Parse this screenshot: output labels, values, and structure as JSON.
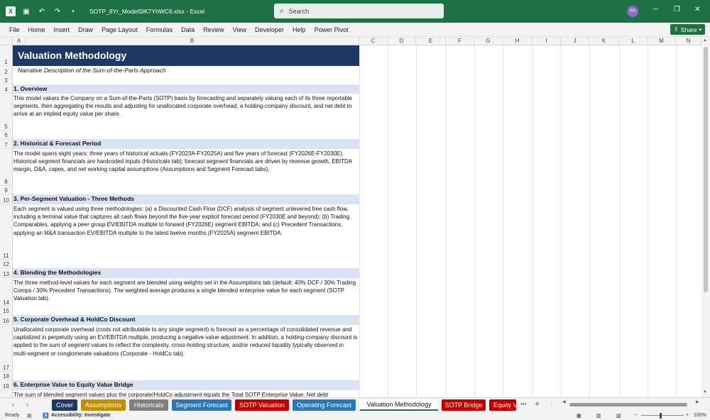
{
  "titlebar": {
    "filename": "SOTP_8Yr_ModelSIK7YhWC6.xlsx",
    "app": "Excel",
    "search_placeholder": "Search",
    "user_initials": "RS",
    "save_icon": "save-icon",
    "undo_icon": "undo-icon",
    "redo_icon": "redo-icon",
    "minimize": "─",
    "restore": "❐",
    "close": "✕"
  },
  "menu": {
    "items": [
      "File",
      "Home",
      "Insert",
      "Draw",
      "Page Layout",
      "Formulas",
      "Data",
      "Review",
      "View",
      "Developer",
      "Help",
      "Power Pivot"
    ],
    "share_label": "Share"
  },
  "columns": [
    "A",
    "B",
    "C",
    "D",
    "E",
    "F",
    "G",
    "H",
    "I",
    "J",
    "K",
    "L",
    "M",
    "N"
  ],
  "rows": [
    "1",
    "2",
    "3",
    "4",
    "5",
    "6",
    "7",
    "8",
    "9",
    "10",
    "11",
    "12",
    "13",
    "14",
    "15",
    "16",
    "17",
    "18",
    "19"
  ],
  "sheet": {
    "title": "Valuation Methodology",
    "subtitle": "Narrative Description of the Sum-of-the-Parts Approach",
    "sections": [
      {
        "heading": "1. Overview",
        "body": "This model values the Company on a Sum-of-the-Parts (SOTP) basis by forecasting and separately valuing each of its three reportable segments, then aggregating the results and adjusting for unallocated corporate overhead, a holding-company discount, and net debt to arrive at an implied equity value per share."
      },
      {
        "heading": "2. Historical & Forecast Period",
        "body": "The model spans eight years: three years of historical actuals (FY2023A-FY2025A) and five years of forecast (FY2026E-FY2030E). Historical segment financials are hardcoded inputs (Historicals tab); forecast segment financials are driven by revenue growth, EBITDA margin, D&A, capex, and net working capital assumptions (Assumptions and Segment Forecast tabs)."
      },
      {
        "heading": "3. Per-Segment Valuation - Three Methods",
        "body": "Each segment is valued using three methodologies: (a) a Discounted Cash Flow (DCF) analysis of segment unlevered free cash flow, including a terminal value that captures all cash flows beyond the five-year explicit forecast period (FY2030E and beyond); (b) Trading Comparables, applying a peer group EV/EBITDA multiple to forward (FY2026E) segment EBITDA; and (c) Precedent Transactions, applying an M&A transaction EV/EBITDA multiple to the latest twelve months (FY2025A) segment EBITDA."
      },
      {
        "heading": "4. Blending the Methodologies",
        "body": "The three method-level values for each segment are blended using weights set in the Assumptions tab (default: 40% DCF / 30% Trading Comps / 30% Precedent Transactions). The weighted average produces a single blended enterprise value for each segment (SOTP Valuation tab)."
      },
      {
        "heading": "5. Corporate Overhead & HoldCo Discount",
        "body": "Unallocated corporate overhead (costs not attributable to any single segment) is forecast as a percentage of consolidated revenue and capitalized in perpetuity using an EV/EBITDA multiple, producing a negative value adjustment. In addition, a holding-company discount is applied to the sum of segment values to reflect the complexity, cross-holding structure, and/or reduced liquidity typically observed in multi-segment or conglomerate valuations (Corporate - HoldCo tab)."
      },
      {
        "heading": "6. Enterprise Value to Equity Value Bridge",
        "body": "The sum of blended segment values plus the corporate/HoldCo adjustment equals the Total SOTP Enterprise Value. Net debt"
      }
    ]
  },
  "tabs": [
    {
      "label": "Cover",
      "color": "#1f3864"
    },
    {
      "label": "Assumptions",
      "color": "#bf9000"
    },
    {
      "label": "Historicals",
      "color": "#7f7f7f"
    },
    {
      "label": "Segment Forecast",
      "color": "#2e75b6"
    },
    {
      "label": "SOTP Valuation",
      "color": "#c00000"
    },
    {
      "label": "Operating Forecast",
      "color": "#2e75b6"
    },
    {
      "label": "Valuation Methodology",
      "color": "#ffffff"
    },
    {
      "label": "SOTP Bridge",
      "color": "#c00000"
    },
    {
      "label": "Equity V",
      "color": "#c00000"
    }
  ],
  "tab_controls": {
    "more": "•••",
    "add": "+"
  },
  "status": {
    "ready": "Ready",
    "accessibility": "Accessibility: Investigate",
    "zoom": "100%"
  }
}
